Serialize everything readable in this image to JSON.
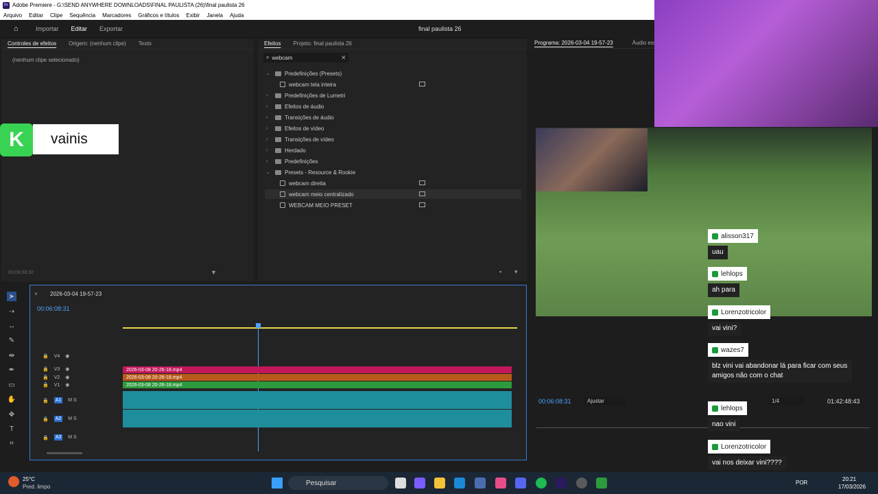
{
  "window": {
    "title": "Adobe Premiere - G:\\SEND ANYWHERE DOWNLOADS\\FINAL PAULISTA (26)\\final paulista 26",
    "app_icon": "Pr"
  },
  "menu": [
    "Arquivo",
    "Editar",
    "Clipe",
    "Sequência",
    "Marcadores",
    "Gráficos e títulos",
    "Exibir",
    "Janela",
    "Ajuda"
  ],
  "appbar": {
    "tabs": [
      "Importar",
      "Editar",
      "Exportar"
    ],
    "active_tab": "Editar",
    "project_name": "final paulista 26"
  },
  "left_panel": {
    "tabs": [
      "Controles de efeitos",
      "Origem: (nenhum clipe)",
      "Texto"
    ],
    "no_clip": "(nenhum clipe selecionado)",
    "timecode": "00;06;08;32"
  },
  "overlay": {
    "logo_letter": "K",
    "name": "vainis"
  },
  "effects_panel": {
    "tabs": [
      "Efeitos",
      "Projeto: final paulista 26"
    ],
    "search_value": "webcam",
    "tree": [
      {
        "label": "Predefinições (Presets)",
        "type": "folder",
        "open": true
      },
      {
        "label": "webcam tela inteira",
        "type": "preset"
      },
      {
        "label": "Predefinições de Lumetri",
        "type": "folder"
      },
      {
        "label": "Efeitos de áudio",
        "type": "folder"
      },
      {
        "label": "Transições de áudio",
        "type": "folder"
      },
      {
        "label": "Efeitos de vídeo",
        "type": "folder"
      },
      {
        "label": "Transições de vídeo",
        "type": "folder"
      },
      {
        "label": "Herdado",
        "type": "folder"
      },
      {
        "label": "Predefinições",
        "type": "folder"
      },
      {
        "label": "Presets - Resource & Rookie",
        "type": "folder",
        "open": true
      },
      {
        "label": "webcam direita",
        "type": "preset"
      },
      {
        "label": "webcam meio centralizado",
        "type": "preset",
        "highlight": true
      },
      {
        "label": "WEBCAM MEIO PRESET",
        "type": "preset"
      }
    ]
  },
  "timeline": {
    "sequence": "2026-03-04 19-57-23",
    "timecode": "00:06:08:31",
    "video_tracks": [
      "V4",
      "V3",
      "V2",
      "V1"
    ],
    "audio_tracks": [
      "A1",
      "A2",
      "A3"
    ],
    "clip_name": "2026-03-08 20-26-18.mp4",
    "fx": "fx",
    "clip_colors": {
      "V3": "#c2185b",
      "V2": "#b85a1a",
      "V1": "#2e9a3e"
    }
  },
  "program": {
    "title": "Programa: 2026-03-04 19-57-23",
    "next_tab": "Áudio essenc",
    "timecode": "00:06:08:31",
    "fit": "Ajustar",
    "scale": "1/4",
    "duration": "01:42:48:43"
  },
  "chat": [
    {
      "user": "alisson317",
      "msg": "uau"
    },
    {
      "user": "lehlops",
      "msg": "ah para"
    },
    {
      "user": "Lorenzotricolor",
      "msg": "vai vini?"
    },
    {
      "user": "wazes7",
      "msg": "blz vini vai abandonar lá para ficar com seus amigos não com o chat"
    },
    {
      "user": "lehlops",
      "msg": "nao vini"
    },
    {
      "user": "Lorenzotricolor",
      "msg": "vai nos deixar vini????"
    }
  ],
  "taskbar": {
    "weather_temp": "25°C",
    "weather_desc": "Pred. limpo",
    "search": "Pesquisar",
    "lang": "POR",
    "time": "20:21",
    "date": "17/03/2026"
  }
}
